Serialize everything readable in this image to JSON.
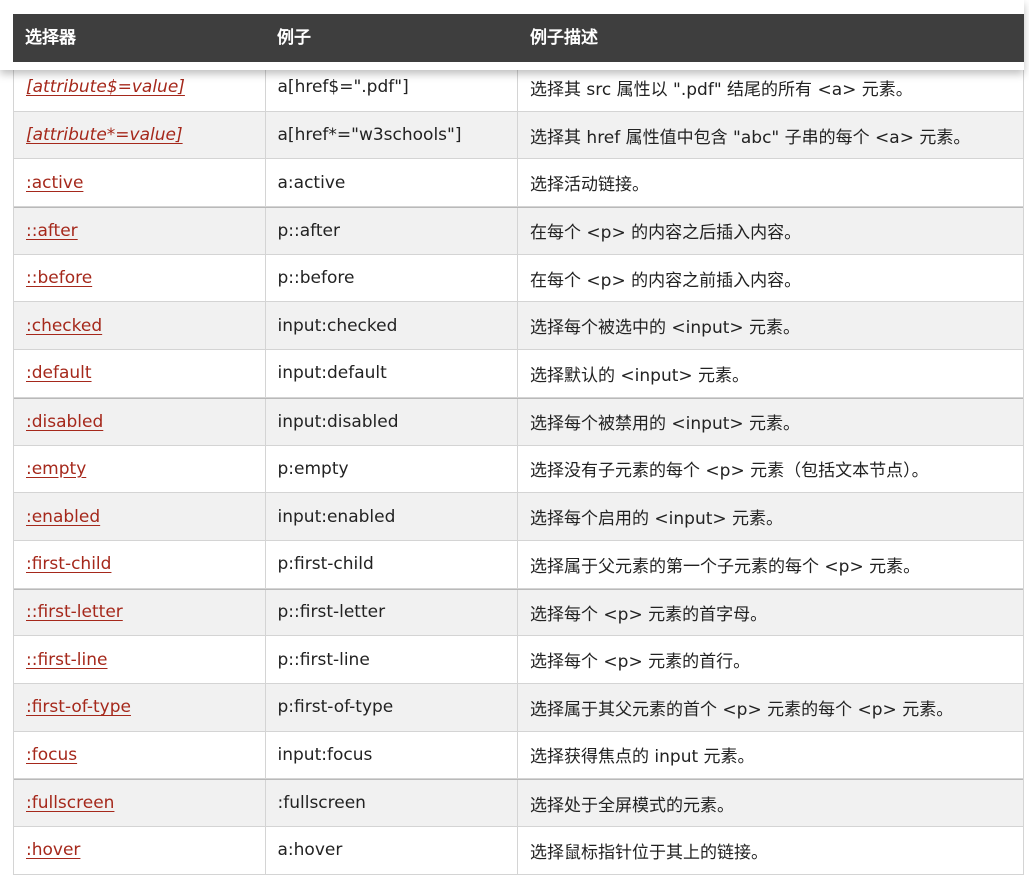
{
  "header": {
    "col1": "选择器",
    "col2": "例子",
    "col3": "例子描述"
  },
  "colors": {
    "header_bg": "#3e3e3e",
    "link": "#a5281b",
    "alt_row": "#f1f1f1"
  },
  "rows": [
    {
      "selector": "[attribute$=value]",
      "example": "a[href$=\".pdf\"]",
      "description": "选择其 src 属性以 \".pdf\" 结尾的所有 <a> 元素。"
    },
    {
      "selector": "[attribute*=value]",
      "example": "a[href*=\"w3schools\"]",
      "description": "选择其 href 属性值中包含 \"abc\" 子串的每个 <a> 元素。"
    },
    {
      "selector": ":active",
      "example": "a:active",
      "description": "选择活动链接。"
    },
    {
      "selector": "::after",
      "example": "p::after",
      "description": "在每个 <p> 的内容之后插入内容。"
    },
    {
      "selector": "::before",
      "example": "p::before",
      "description": "在每个 <p> 的内容之前插入内容。"
    },
    {
      "selector": ":checked",
      "example": "input:checked",
      "description": "选择每个被选中的 <input> 元素。"
    },
    {
      "selector": ":default",
      "example": "input:default",
      "description": "选择默认的 <input> 元素。"
    },
    {
      "selector": ":disabled",
      "example": "input:disabled",
      "description": "选择每个被禁用的 <input> 元素。"
    },
    {
      "selector": ":empty",
      "example": "p:empty",
      "description": "选择没有子元素的每个 <p> 元素（包括文本节点）。"
    },
    {
      "selector": ":enabled",
      "example": "input:enabled",
      "description": "选择每个启用的 <input> 元素。"
    },
    {
      "selector": ":first-child",
      "example": "p:first-child",
      "description": "选择属于父元素的第一个子元素的每个 <p> 元素。"
    },
    {
      "selector": "::first-letter",
      "example": "p::first-letter",
      "description": "选择每个 <p> 元素的首字母。"
    },
    {
      "selector": "::first-line",
      "example": "p::first-line",
      "description": "选择每个 <p> 元素的首行。"
    },
    {
      "selector": ":first-of-type",
      "example": "p:first-of-type",
      "description": "选择属于其父元素的首个 <p> 元素的每个 <p> 元素。"
    },
    {
      "selector": ":focus",
      "example": "input:focus",
      "description": "选择获得焦点的 input 元素。"
    },
    {
      "selector": ":fullscreen",
      "example": ":fullscreen",
      "description": "选择处于全屏模式的元素。"
    },
    {
      "selector": ":hover",
      "example": "a:hover",
      "description": "选择鼠标指针位于其上的链接。"
    }
  ]
}
